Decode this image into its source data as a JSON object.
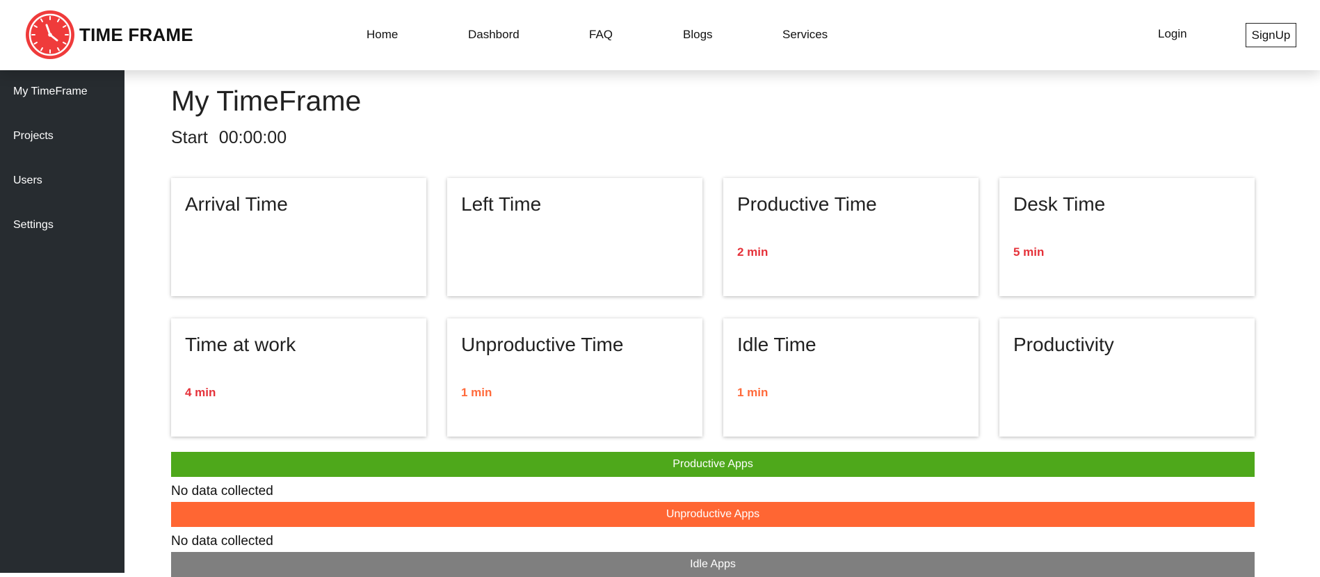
{
  "brand": {
    "name": "TIME FRAME"
  },
  "nav": {
    "links": [
      "Home",
      "Dashbord",
      "FAQ",
      "Blogs",
      "Services"
    ],
    "login": "Login",
    "signup": "SignUp"
  },
  "sidebar": {
    "items": [
      {
        "label": "My TimeFrame"
      },
      {
        "label": "Projects"
      },
      {
        "label": "Users"
      },
      {
        "label": "Settings"
      }
    ]
  },
  "main": {
    "title": "My TimeFrame",
    "timer_label": "Start",
    "timer_value": "00:00:00",
    "cards": [
      {
        "title": "Arrival Time",
        "value": ""
      },
      {
        "title": "Left Time",
        "value": ""
      },
      {
        "title": "Productive Time",
        "value": "2 min"
      },
      {
        "title": "Desk Time",
        "value": "5 min"
      },
      {
        "title": "Time at work",
        "value": "4 min"
      },
      {
        "title": "Unproductive Time",
        "value": "1 min"
      },
      {
        "title": "Idle Time",
        "value": "1 min"
      },
      {
        "title": "Productivity",
        "value": ""
      }
    ],
    "sections": [
      {
        "label": "Productive Apps",
        "empty_text": "No data collected"
      },
      {
        "label": "Unproductive Apps",
        "empty_text": "No data collected"
      },
      {
        "label": "Idle Apps"
      }
    ]
  },
  "colors": {
    "accent_red": "#e5323a",
    "accent_orange": "#ff6a3b",
    "productive_green": "#4ea81b",
    "unproductive_orange": "#ff6633",
    "idle_gray": "#7f7f7f",
    "sidebar_bg": "#272c30"
  }
}
